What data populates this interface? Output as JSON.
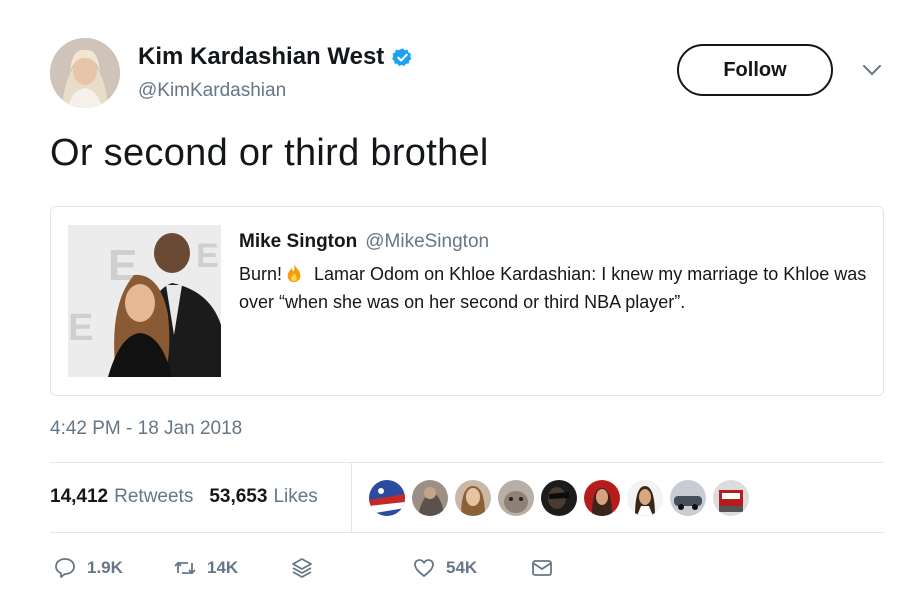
{
  "author": {
    "name": "Kim Kardashian West",
    "handle": "@KimKardashian",
    "verified": true
  },
  "follow_label": "Follow",
  "tweet_text": "Or second or third brothel",
  "quoted": {
    "name": "Mike Sington",
    "handle": "@MikeSington",
    "text_before_emoji": "Burn!",
    "emoji": "fire-icon",
    "text_after_emoji": " Lamar Odom on Khloe Kardashian: I knew my marriage to Khloe was over “when she was on her second or third NBA player”."
  },
  "timestamp": "4:42 PM - 18 Jan 2018",
  "stats": {
    "retweets_count": "14,412",
    "retweets_label": "Retweets",
    "likes_count": "53,653",
    "likes_label": "Likes"
  },
  "actions": {
    "reply_count": "1.9K",
    "retweet_count": "14K",
    "like_count": "54K"
  },
  "colors": {
    "verified_blue": "#1da1f2",
    "muted": "#657786",
    "text": "#14171a",
    "border": "#e1e8ed",
    "fire": "#f59e0b"
  }
}
